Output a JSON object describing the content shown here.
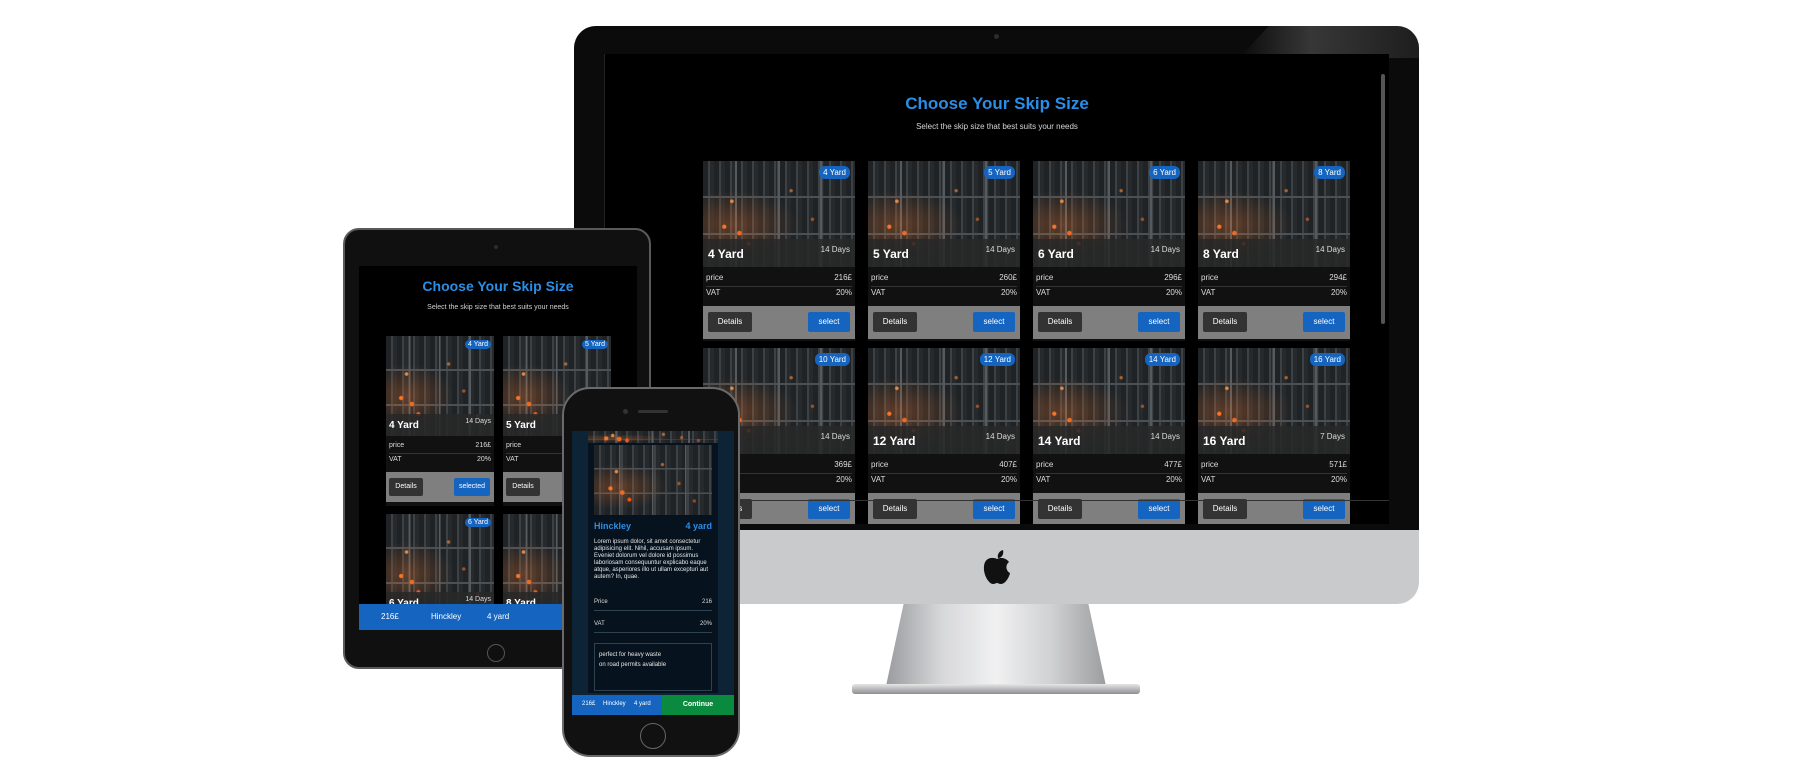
{
  "desktop": {
    "title": "Choose Your Skip Size",
    "subtitle": "Select the skip size that best suits your needs",
    "price_label": "price",
    "vat_label": "VAT",
    "details_label": "Details",
    "select_label": "select",
    "cards": [
      {
        "badge": "4 Yard",
        "name": "4 Yard",
        "days": "14 Days",
        "price": "216£",
        "vat": "20%"
      },
      {
        "badge": "5 Yard",
        "name": "5 Yard",
        "days": "14 Days",
        "price": "260£",
        "vat": "20%"
      },
      {
        "badge": "6 Yard",
        "name": "6 Yard",
        "days": "14 Days",
        "price": "296£",
        "vat": "20%"
      },
      {
        "badge": "8 Yard",
        "name": "8 Yard",
        "days": "14 Days",
        "price": "294£",
        "vat": "20%"
      },
      {
        "badge": "10 Yard",
        "name": "",
        "days": "14 Days",
        "price": "369£",
        "vat": "20%"
      },
      {
        "badge": "12 Yard",
        "name": "12 Yard",
        "days": "14 Days",
        "price": "407£",
        "vat": "20%"
      },
      {
        "badge": "14 Yard",
        "name": "14 Yard",
        "days": "14 Days",
        "price": "477£",
        "vat": "20%"
      },
      {
        "badge": "16 Yard",
        "name": "16 Yard",
        "days": "7 Days",
        "price": "571£",
        "vat": "20%"
      }
    ]
  },
  "tablet": {
    "title": "Choose Your Skip Size",
    "subtitle": "Select the skip size that best suits your needs",
    "price_label": "price",
    "vat_label": "VAT",
    "details_label": "Details",
    "selected_label": "selected",
    "cards": [
      {
        "badge": "4 Yard",
        "name": "4 Yard",
        "days": "14 Days",
        "price": "216£",
        "vat": "20%"
      },
      {
        "badge": "5 Yard",
        "name": "5 Yard",
        "days": "",
        "price": "",
        "vat": ""
      },
      {
        "badge": "6 Yard",
        "name": "6 Yard",
        "days": "14 Days"
      },
      {
        "badge": "",
        "name": "8 Yard",
        "days": ""
      }
    ],
    "bottom_bar": {
      "price": "216£",
      "location": "Hinckley",
      "size": "4 yard"
    }
  },
  "phone": {
    "location": "Hinckley",
    "size": "4 yard",
    "description": "Lorem ipsum dolor, sit amet consectetur adipisicing elit. Nihil, accusam ipsum. Eveniet dolorum vel dolore id possimus laboriosam consequuntur explicabo eaque atque, asperiores illo ut ullam excepturi aut autem? In, quae.",
    "price_label": "Price",
    "price_value": "216",
    "vat_label": "VAT",
    "vat_value": "20%",
    "note_1": "perfect for heavy waste",
    "note_2": "on road permits available",
    "bottom_bar": {
      "price": "216£",
      "location": "Hinckley",
      "size": "4 yard",
      "continue_label": "Continue"
    }
  },
  "colors": {
    "accent": "#2a8ee6",
    "button_blue": "#1565c0",
    "continue_green": "#0a8a3e"
  },
  "icons": {
    "brand": "apple-logo-icon"
  }
}
